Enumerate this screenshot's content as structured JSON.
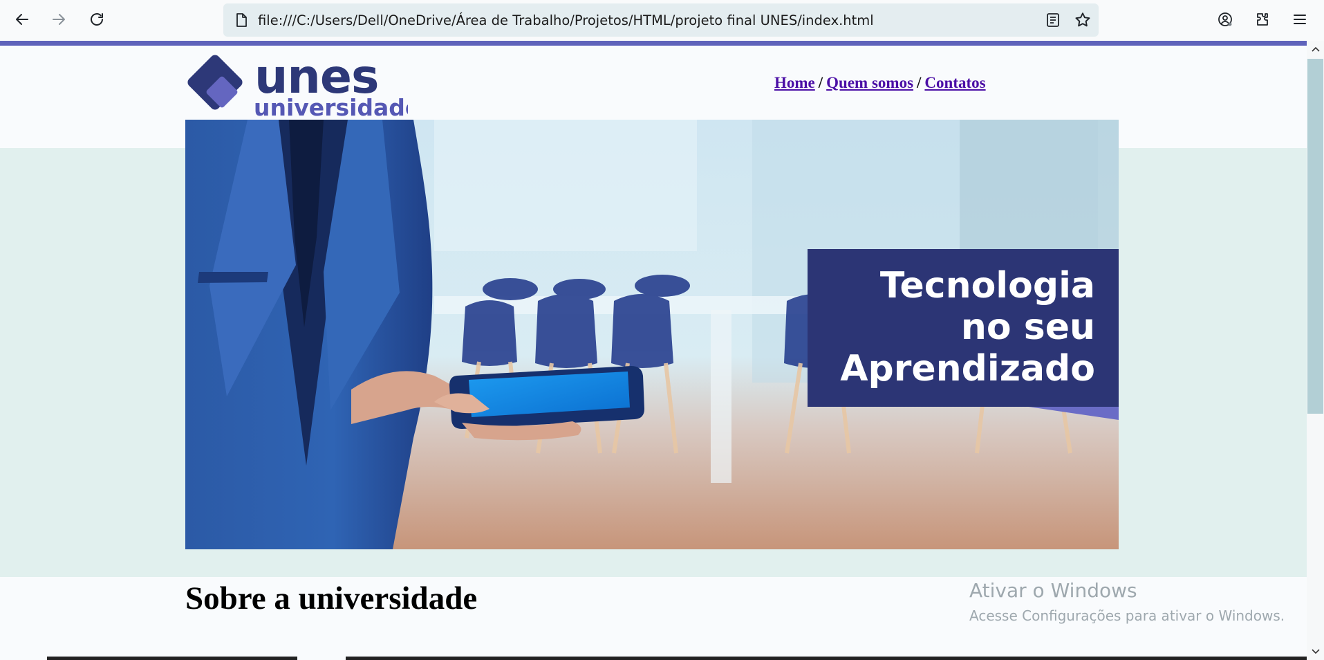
{
  "browser": {
    "url": "file:///C:/Users/Dell/OneDrive/Área de Trabalho/Projetos/HTML/projeto final UNES/index.html",
    "icons": [
      "back-icon",
      "forward-icon",
      "reload-icon",
      "page-icon",
      "reader-view-icon",
      "bookmark-star-icon",
      "account-icon",
      "extensions-icon",
      "menu-icon"
    ]
  },
  "header": {
    "logo_main": "unes",
    "logo_sub": "universidade",
    "nav": [
      {
        "label": "Home"
      },
      {
        "label": "Quem somos"
      },
      {
        "label": "Contatos"
      }
    ],
    "nav_separator": "/"
  },
  "hero": {
    "headline_line1": "Tecnologia",
    "headline_line2": "no seu",
    "headline_line3": "Aprendizado"
  },
  "main": {
    "section_title": "Sobre a universidade"
  },
  "watermark": {
    "title": "Ativar o Windows",
    "subtitle": "Acesse Configurações para ativar o Windows."
  },
  "colors": {
    "brand_navy": "#2d3878",
    "brand_purple": "#5f63bb",
    "band_background": "#e1f0ee",
    "link": "#4b0fa6"
  }
}
